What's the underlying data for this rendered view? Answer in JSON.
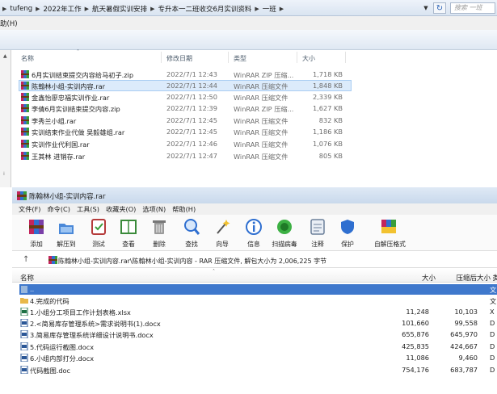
{
  "explorer": {
    "breadcrumbs": [
      "tufeng",
      "2022年工作",
      "航天暑假实训安排",
      "专升本一二班收交6月实训资料",
      "一班"
    ],
    "search_placeholder": "搜索 一班",
    "menu_help": "助(H)",
    "columns": {
      "name": "名称",
      "date": "修改日期",
      "type": "类型",
      "size": "大小"
    },
    "files": [
      {
        "name": "6月实训结束提交内容给马初子.zip",
        "date": "2022/7/1 12:43",
        "type": "WinRAR ZIP 压缩...",
        "size": "1,718 KB",
        "selected": false
      },
      {
        "name": "陈翰林小组-实训内容.rar",
        "date": "2022/7/1 12:44",
        "type": "WinRAR 压缩文件",
        "size": "1,848 KB",
        "selected": true
      },
      {
        "name": "金鑫怡廖忠福实训作业.rar",
        "date": "2022/7/1 12:50",
        "type": "WinRAR 压缩文件",
        "size": "2,339 KB",
        "selected": false
      },
      {
        "name": "李倩6月实训结束提交内容.zip",
        "date": "2022/7/1 12:39",
        "type": "WinRAR ZIP 压缩...",
        "size": "1,627 KB",
        "selected": false
      },
      {
        "name": "李秀兰小组.rar",
        "date": "2022/7/1 12:45",
        "type": "WinRAR 压缩文件",
        "size": "832 KB",
        "selected": false
      },
      {
        "name": "实训结束作业代做 吴毅雄组.rar",
        "date": "2022/7/1 12:45",
        "type": "WinRAR 压缩文件",
        "size": "1,186 KB",
        "selected": false
      },
      {
        "name": "实训作业代利国.rar",
        "date": "2022/7/1 12:46",
        "type": "WinRAR 压缩文件",
        "size": "1,076 KB",
        "selected": false
      },
      {
        "name": "王其林 进销存.rar",
        "date": "2022/7/1 12:47",
        "type": "WinRAR 压缩文件",
        "size": "805 KB",
        "selected": false
      }
    ]
  },
  "winrar": {
    "title": "陈翰林小组-实训内容.rar",
    "menus": [
      "文件(F)",
      "命令(C)",
      "工具(S)",
      "收藏夹(O)",
      "选项(N)",
      "帮助(H)"
    ],
    "tools": [
      "添加",
      "解压到",
      "测试",
      "查看",
      "删除",
      "查找",
      "向导",
      "信息",
      "扫描病毒",
      "注释",
      "保护",
      "自解压格式"
    ],
    "path_text": "陈翰林小组-实训内容.rar\\陈翰林小组-实训内容 - RAR 压缩文件, 解包大小为 2,006,225 字节",
    "up_arrow": "↑",
    "columns": {
      "name": "名称",
      "size": "大小",
      "packed": "压缩后大小",
      "type": "类"
    },
    "rows": [
      {
        "name": "..",
        "size": "",
        "packed": "",
        "type": "文",
        "selected": true,
        "kind": "up"
      },
      {
        "name": "4.完成的代码",
        "size": "",
        "packed": "",
        "type": "文",
        "selected": false,
        "kind": "folder"
      },
      {
        "name": "1.小组分工项目工作计划表格.xlsx",
        "size": "11,248",
        "packed": "10,103",
        "type": "X",
        "selected": false,
        "kind": "xlsx"
      },
      {
        "name": "2.<简易库存管理系统>需求说明书(1).docx",
        "size": "101,660",
        "packed": "99,558",
        "type": "D",
        "selected": false,
        "kind": "docx"
      },
      {
        "name": "3.简易库存管理系统详细设计说明书.docx",
        "size": "655,876",
        "packed": "645,970",
        "type": "D",
        "selected": false,
        "kind": "docx"
      },
      {
        "name": "5.代码运行截图.docx",
        "size": "425,835",
        "packed": "424,667",
        "type": "D",
        "selected": false,
        "kind": "docx"
      },
      {
        "name": "6.小组内部打分.docx",
        "size": "11,086",
        "packed": "9,460",
        "type": "D",
        "selected": false,
        "kind": "docx"
      },
      {
        "name": "代码截图.doc",
        "size": "754,176",
        "packed": "683,787",
        "type": "D",
        "selected": false,
        "kind": "doc"
      }
    ]
  }
}
